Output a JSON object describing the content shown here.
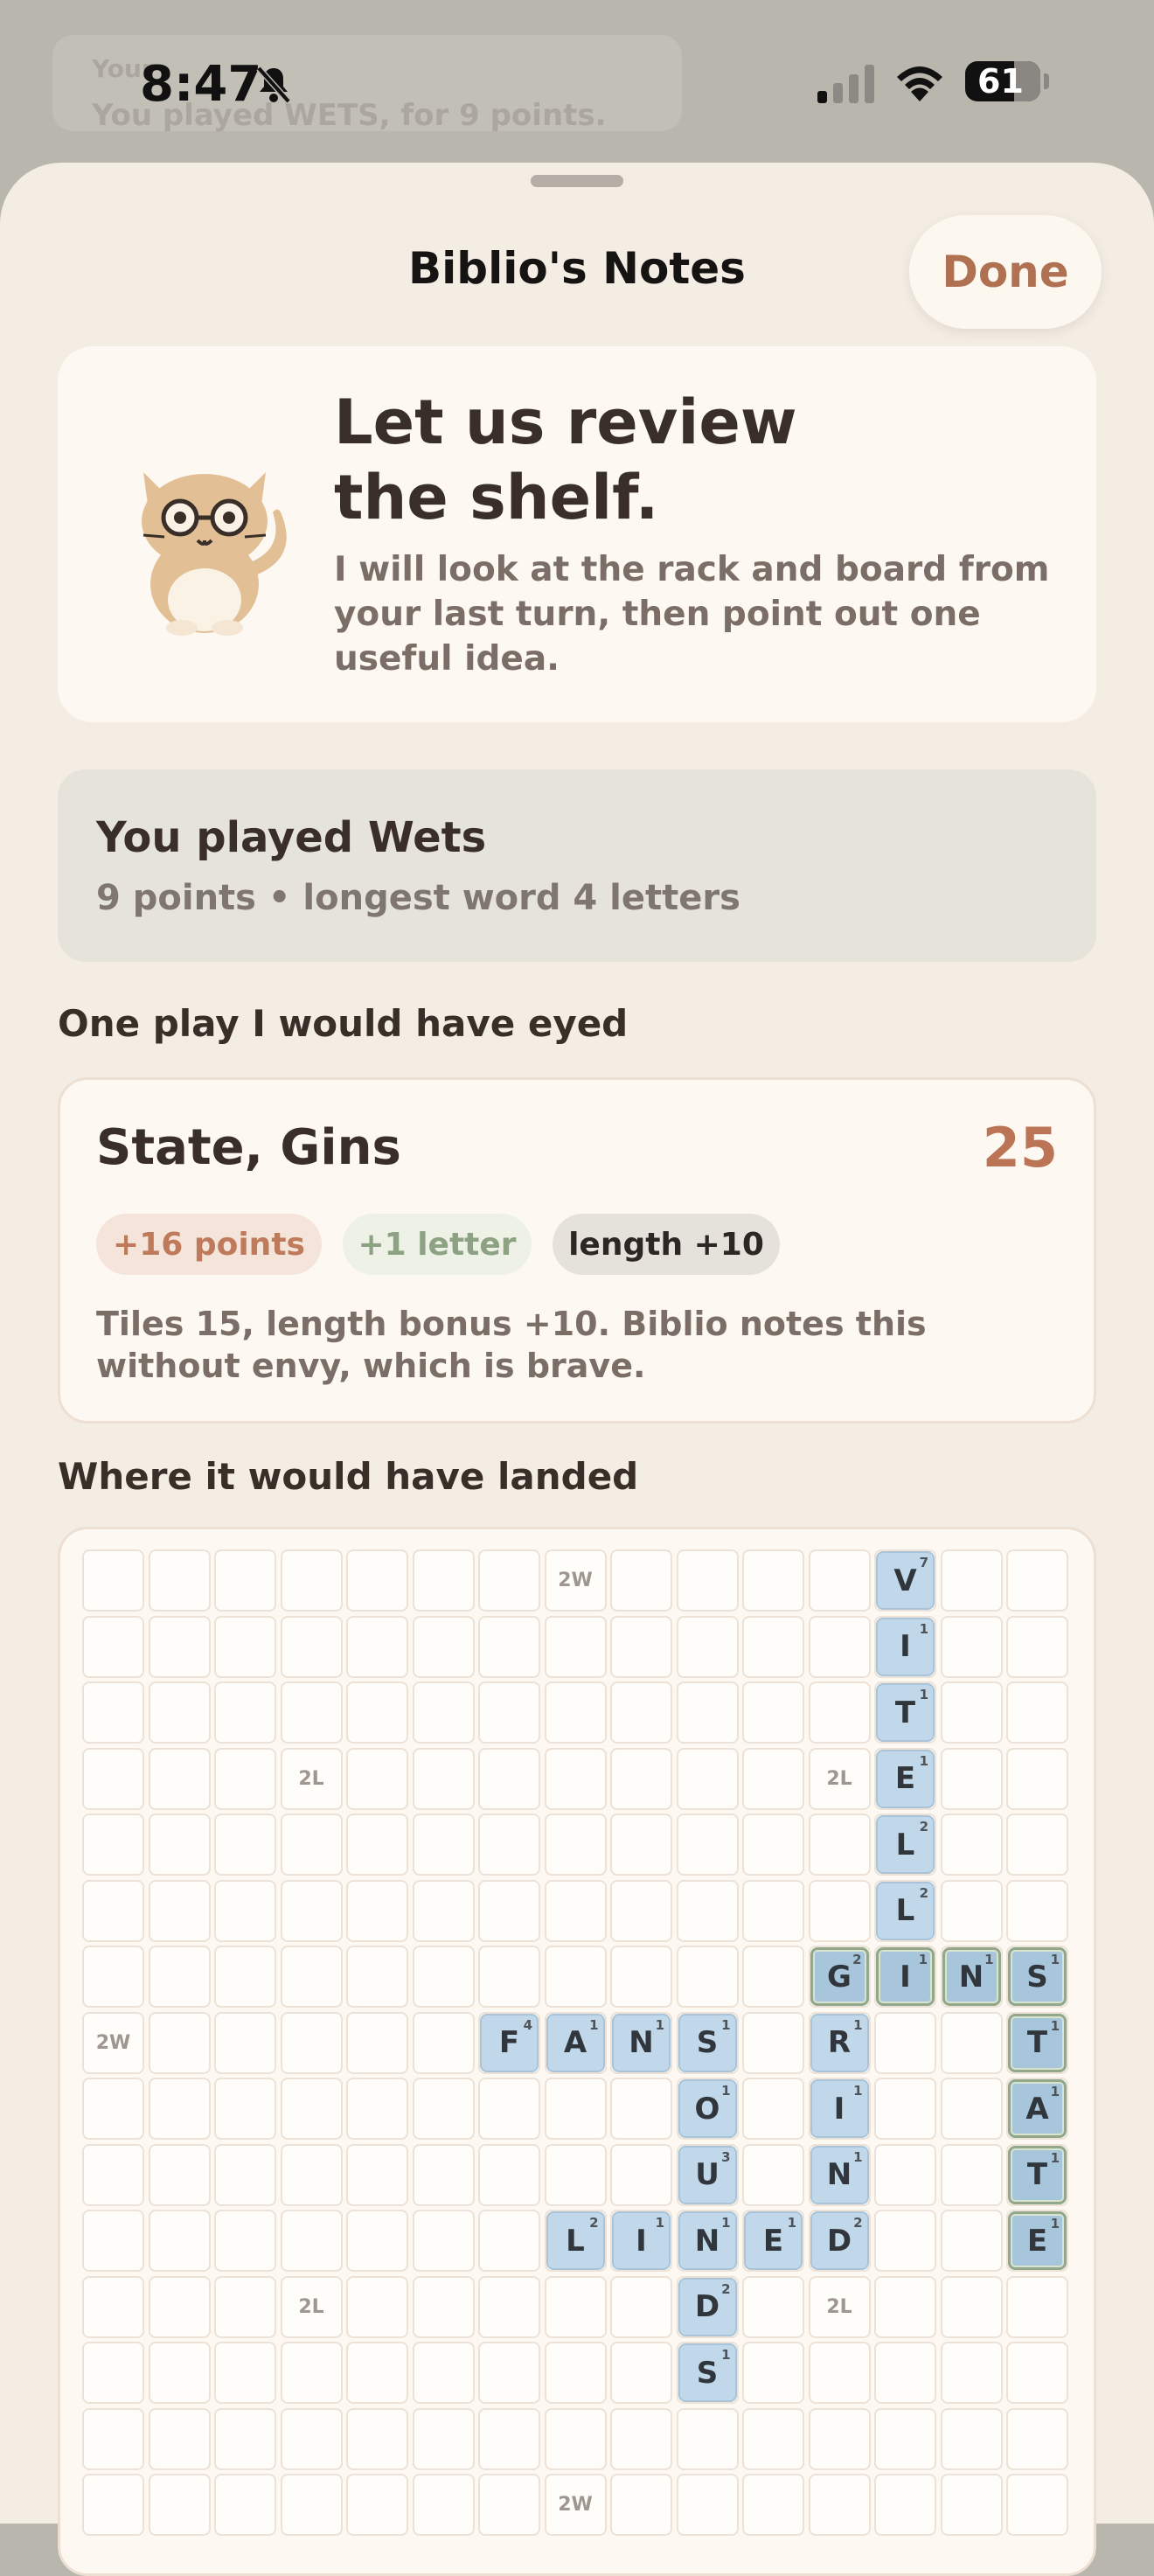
{
  "status_bar": {
    "time": "8:47",
    "battery": "61"
  },
  "behind_sheet": {
    "title": "Your",
    "text": "You played WETS, for 9 points."
  },
  "sheet": {
    "title": "Biblio's Notes",
    "done_label": "Done"
  },
  "hero": {
    "heading_line1": "Let us review",
    "heading_line2": "the shelf.",
    "body": "I will look at the rack and board from your last turn, then point out one useful idea."
  },
  "summary": {
    "heading": "You played Wets",
    "detail": "9 points • longest word 4 letters"
  },
  "suggestion_section": {
    "heading": "One play I would have eyed",
    "play_words": "State, Gins",
    "score": "25",
    "chips": [
      "+16 points",
      "+1 letter",
      "length +10"
    ],
    "note": "Tiles 15, length bonus +10. Biblio notes this without envy, which is brave."
  },
  "board_section": {
    "heading": "Where it would have landed",
    "grid_size": 15,
    "visible_rows": 15,
    "premiums": [
      {
        "row": 0,
        "col": 7,
        "label": "2W"
      },
      {
        "row": 3,
        "col": 3,
        "label": "2L"
      },
      {
        "row": 3,
        "col": 11,
        "label": "2L"
      },
      {
        "row": 7,
        "col": 0,
        "label": "2W"
      },
      {
        "row": 11,
        "col": 3,
        "label": "2L"
      },
      {
        "row": 11,
        "col": 11,
        "label": "2L"
      },
      {
        "row": 14,
        "col": 7,
        "label": "2W"
      }
    ],
    "tiles": [
      {
        "row": 0,
        "col": 12,
        "letter": "V",
        "points": "7",
        "new": false
      },
      {
        "row": 1,
        "col": 12,
        "letter": "I",
        "points": "1",
        "new": false
      },
      {
        "row": 2,
        "col": 12,
        "letter": "T",
        "points": "1",
        "new": false
      },
      {
        "row": 3,
        "col": 12,
        "letter": "E",
        "points": "1",
        "new": false
      },
      {
        "row": 4,
        "col": 12,
        "letter": "L",
        "points": "2",
        "new": false
      },
      {
        "row": 5,
        "col": 12,
        "letter": "L",
        "points": "2",
        "new": false
      },
      {
        "row": 6,
        "col": 11,
        "letter": "G",
        "points": "2",
        "new": true
      },
      {
        "row": 6,
        "col": 12,
        "letter": "I",
        "points": "1",
        "new": true
      },
      {
        "row": 6,
        "col": 13,
        "letter": "N",
        "points": "1",
        "new": true
      },
      {
        "row": 6,
        "col": 14,
        "letter": "S",
        "points": "1",
        "new": true
      },
      {
        "row": 7,
        "col": 6,
        "letter": "F",
        "points": "4",
        "new": false
      },
      {
        "row": 7,
        "col": 7,
        "letter": "A",
        "points": "1",
        "new": false
      },
      {
        "row": 7,
        "col": 8,
        "letter": "N",
        "points": "1",
        "new": false
      },
      {
        "row": 7,
        "col": 9,
        "letter": "S",
        "points": "1",
        "new": false
      },
      {
        "row": 7,
        "col": 11,
        "letter": "R",
        "points": "1",
        "new": false
      },
      {
        "row": 7,
        "col": 14,
        "letter": "T",
        "points": "1",
        "new": true
      },
      {
        "row": 8,
        "col": 9,
        "letter": "O",
        "points": "1",
        "new": false
      },
      {
        "row": 8,
        "col": 11,
        "letter": "I",
        "points": "1",
        "new": false
      },
      {
        "row": 8,
        "col": 14,
        "letter": "A",
        "points": "1",
        "new": true
      },
      {
        "row": 9,
        "col": 9,
        "letter": "U",
        "points": "3",
        "new": false
      },
      {
        "row": 9,
        "col": 11,
        "letter": "N",
        "points": "1",
        "new": false
      },
      {
        "row": 9,
        "col": 14,
        "letter": "T",
        "points": "1",
        "new": true
      },
      {
        "row": 10,
        "col": 7,
        "letter": "L",
        "points": "2",
        "new": false
      },
      {
        "row": 10,
        "col": 8,
        "letter": "I",
        "points": "1",
        "new": false
      },
      {
        "row": 10,
        "col": 9,
        "letter": "N",
        "points": "1",
        "new": false
      },
      {
        "row": 10,
        "col": 10,
        "letter": "E",
        "points": "1",
        "new": false
      },
      {
        "row": 10,
        "col": 11,
        "letter": "D",
        "points": "2",
        "new": false
      },
      {
        "row": 10,
        "col": 14,
        "letter": "E",
        "points": "1",
        "new": true
      },
      {
        "row": 11,
        "col": 9,
        "letter": "D",
        "points": "2",
        "new": false
      },
      {
        "row": 12,
        "col": 9,
        "letter": "S",
        "points": "1",
        "new": false
      }
    ]
  },
  "colors": {
    "accent": "#b07152",
    "score": "#bb7456",
    "tile": "#c0d8ea",
    "new_tile_border": "#93a88a"
  }
}
